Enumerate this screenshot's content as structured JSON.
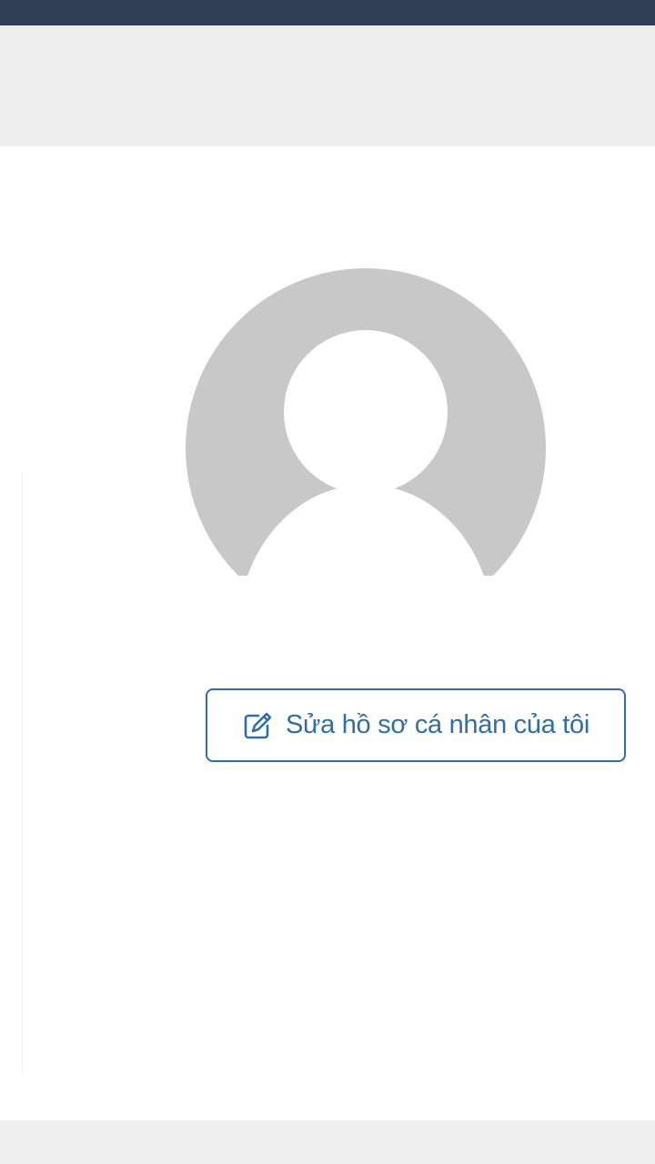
{
  "colors": {
    "top_bar": "#2f3e55",
    "header_band": "#eeeeee",
    "footer_band": "#f0f0f0",
    "avatar_bg": "#c8c8c8",
    "avatar_figure": "#ffffff",
    "accent": "#2f6ea6"
  },
  "profile": {
    "avatar_icon": "default-user-avatar-icon",
    "edit_button": {
      "icon": "edit-icon",
      "label": "Sửa hồ sơ cá nhân của tôi"
    }
  }
}
